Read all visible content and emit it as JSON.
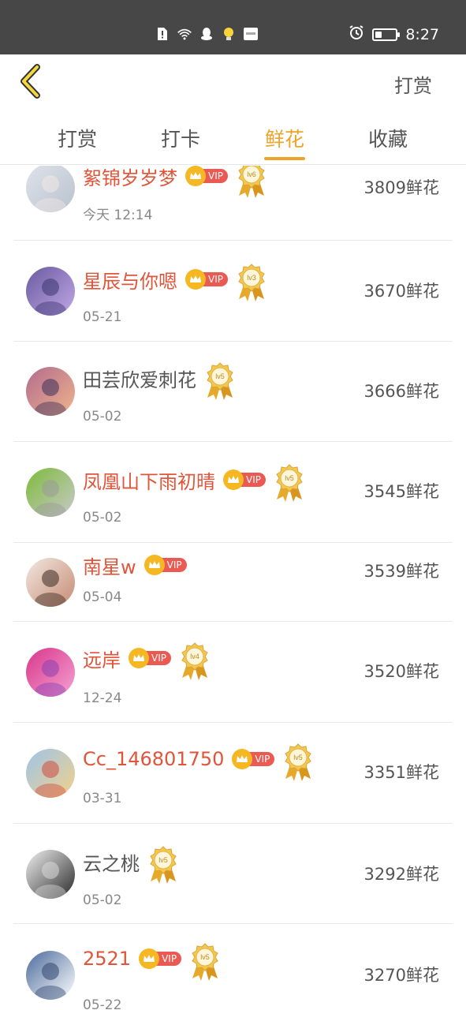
{
  "status_bar": {
    "time": "8:27",
    "icons": [
      "sim-alert-icon",
      "wifi-icon",
      "qq-icon",
      "bulb-icon",
      "app-icon",
      "alarm-icon",
      "battery-icon"
    ],
    "battery_level": 0.35
  },
  "nav": {
    "back_icon": "chevron-left-icon",
    "action_label": "打赏"
  },
  "tabs": [
    {
      "label": "打赏",
      "active": false
    },
    {
      "label": "打卡",
      "active": false
    },
    {
      "label": "鲜花",
      "active": true
    },
    {
      "label": "收藏",
      "active": false
    }
  ],
  "colors": {
    "accent": "#f0a32a",
    "vip_name": "#e0553a",
    "vip_tag": "#ea5a52",
    "crown": "#f5b722",
    "status_bar": "#474747"
  },
  "rows": [
    {
      "name": "絮锦岁岁梦",
      "vip": true,
      "vip_label": "VIP",
      "level": "lv6",
      "date": "今天 12:14",
      "flowers": "3809鲜花"
    },
    {
      "name": "星辰与你嗯",
      "vip": true,
      "vip_label": "VIP",
      "level": "lv3",
      "date": "05-21",
      "flowers": "3670鲜花"
    },
    {
      "name": "田芸欣爱刺花",
      "vip": false,
      "level": "lv5",
      "date": "05-02",
      "flowers": "3666鲜花"
    },
    {
      "name": "凤凰山下雨初晴",
      "vip": true,
      "vip_label": "VIP",
      "level": "lv5",
      "date": "05-02",
      "flowers": "3545鲜花"
    },
    {
      "name": "南星w",
      "vip": true,
      "vip_label": "VIP",
      "level": "",
      "date": "05-04",
      "flowers": "3539鲜花"
    },
    {
      "name": "远岸",
      "vip": true,
      "vip_label": "VIP",
      "level": "lv4",
      "date": "12-24",
      "flowers": "3520鲜花"
    },
    {
      "name": "Cc_146801750",
      "vip": true,
      "vip_label": "VIP",
      "level": "lv5",
      "date": "03-31",
      "flowers": "3351鲜花"
    },
    {
      "name": "云之桃",
      "vip": false,
      "level": "lv5",
      "date": "05-02",
      "flowers": "3292鲜花"
    },
    {
      "name": "2521",
      "vip": true,
      "vip_label": "VIP",
      "level": "lv5",
      "date": "05-22",
      "flowers": "3270鲜花"
    }
  ]
}
